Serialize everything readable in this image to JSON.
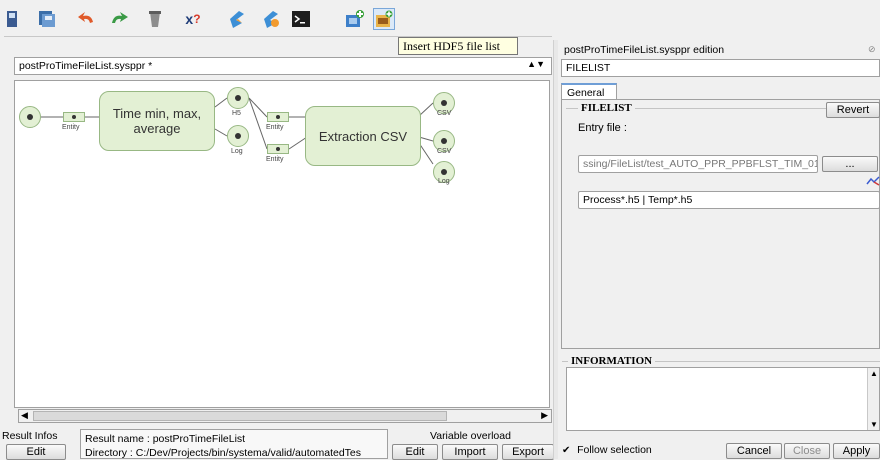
{
  "toolbar": {
    "tooltip": "Insert HDF5 file list",
    "icons": [
      "save-icon",
      "save-all-icon",
      "undo-icon",
      "redo-icon",
      "clear-icon",
      "help-icon",
      "plugin-icon",
      "plugin-alt-icon",
      "terminal-icon",
      "add-processor-icon",
      "insert-hdf5-list-icon"
    ]
  },
  "editor": {
    "file_combo": "postProTimeFileList.sysppr *",
    "nodes": {
      "time_box": "Time min, max, average",
      "extraction_box": "Extraction CSV",
      "ports": {
        "entity": "Entity",
        "h5": "H5",
        "log": "Log",
        "csv": "CSV"
      }
    }
  },
  "bottom": {
    "result_infos": "Result Infos",
    "edit": "Edit",
    "result_name": "Result name : postProTimeFileList",
    "directory": "Directory : C:/Dev/Projects/bin/systema/valid/automatedTes",
    "variable_overload": "Variable overload",
    "edit2": "Edit",
    "import": "Import",
    "export": "Export"
  },
  "side": {
    "title": "postProTimeFileList.sysppr edition",
    "type_field": "FILELIST",
    "tab_general": "General",
    "group_filelist": "FILELIST",
    "revert": "Revert",
    "entry_file_label": "Entry file :",
    "entry_file_value": "ssing/FileList/test_AUTO_PPR_PPBFLST_TIM_01",
    "browse": "...",
    "pattern": "Process*.h5 | Temp*.h5",
    "group_information": "INFORMATION",
    "follow_selection": "Follow selection",
    "cancel": "Cancel",
    "close": "Close",
    "apply": "Apply"
  },
  "colors": {
    "node_fill": "#e3f0d4",
    "node_border": "#98b884",
    "tooltip_bg": "#ffffe1",
    "tab_accent": "#6f9ed6"
  }
}
